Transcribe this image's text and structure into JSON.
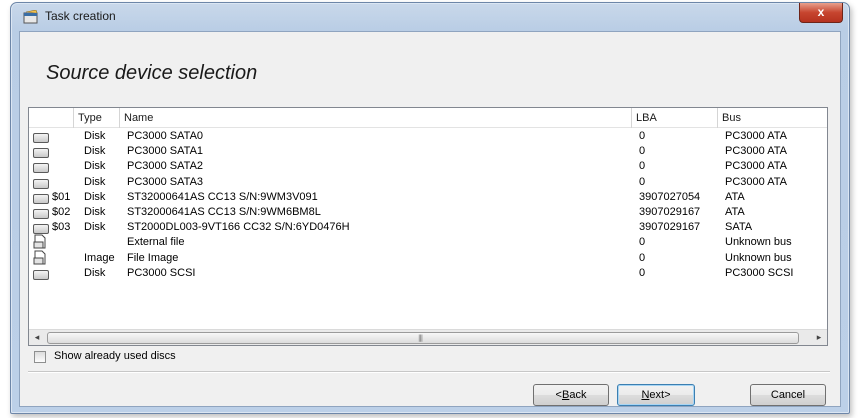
{
  "window": {
    "title": "Task creation",
    "close_label": "x"
  },
  "heading": "Source device selection",
  "table": {
    "columns": [
      "Type",
      "Name",
      "LBA",
      "Bus"
    ],
    "rows": [
      {
        "icon": "drive-icon",
        "id": "",
        "type": "Disk",
        "name": "PC3000 SATA0",
        "lba": "0",
        "bus": "PC3000 ATA"
      },
      {
        "icon": "drive-icon",
        "id": "",
        "type": "Disk",
        "name": "PC3000 SATA1",
        "lba": "0",
        "bus": "PC3000 ATA"
      },
      {
        "icon": "drive-icon",
        "id": "",
        "type": "Disk",
        "name": "PC3000 SATA2",
        "lba": "0",
        "bus": "PC3000 ATA"
      },
      {
        "icon": "drive-icon",
        "id": "",
        "type": "Disk",
        "name": "PC3000 SATA3",
        "lba": "0",
        "bus": "PC3000 ATA"
      },
      {
        "icon": "drive-icon",
        "id": "$01",
        "type": "Disk",
        "name": "ST32000641AS CC13 S/N:9WM3V091",
        "lba": "3907027054",
        "bus": "ATA"
      },
      {
        "icon": "drive-icon",
        "id": "$02",
        "type": "Disk",
        "name": "ST32000641AS CC13 S/N:9WM6BM8L",
        "lba": "3907029167",
        "bus": "ATA"
      },
      {
        "icon": "drive-icon",
        "id": "$03",
        "type": "Disk",
        "name": "ST2000DL003-9VT166 CC32 S/N:6YD0476H",
        "lba": "3907029167",
        "bus": "SATA"
      },
      {
        "icon": "file-icon",
        "id": "",
        "type": "",
        "name": "External file",
        "lba": "0",
        "bus": "Unknown bus"
      },
      {
        "icon": "file-icon",
        "id": "",
        "type": "Image",
        "name": "File Image",
        "lba": "0",
        "bus": "Unknown bus"
      },
      {
        "icon": "drive-icon",
        "id": "",
        "type": "Disk",
        "name": "PC3000 SCSI",
        "lba": "0",
        "bus": "PC3000 SCSI"
      }
    ]
  },
  "scrollbar": {
    "left_arrow": "◂",
    "right_arrow": "▸",
    "grip": "|||"
  },
  "options": {
    "show_used_label": "Show already used discs",
    "show_used_checked": false
  },
  "buttons": {
    "back_mnemonic": "B",
    "back_rest": "ack",
    "back_prefix": "<",
    "next_mnemonic": "N",
    "next_rest": "ext",
    "next_suffix": ">",
    "cancel": "Cancel"
  },
  "colors": {
    "title_bar": "#b9cde5",
    "close_button": "#c7452f",
    "client_bg": "#f0f0f0"
  }
}
